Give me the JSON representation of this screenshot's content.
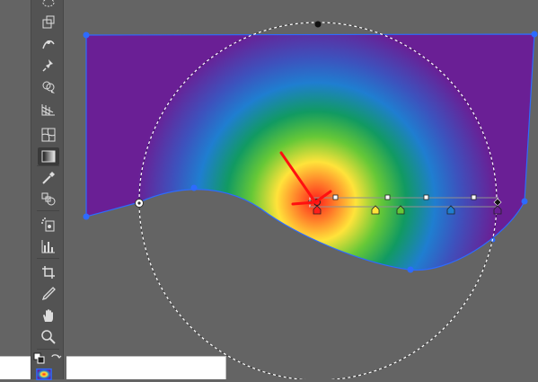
{
  "canvas": {
    "background_color": "#646464",
    "artwork_fill_outer_color": "#6a1f95",
    "gradient_stops": [
      "#ff2a1e",
      "#ffe23a",
      "#7fcf3c",
      "#0f9a5a",
      "#1d78c6",
      "#6a1f95"
    ],
    "selection_color": "#2d6bff",
    "gradient_annotator_color": "#ffffff"
  },
  "toolbar": {
    "tools": [
      {
        "name": "lasso-tool",
        "icon": "lasso-icon"
      },
      {
        "name": "free-transform-tool",
        "icon": "free-transform-icon"
      },
      {
        "name": "puppet-warp-tool",
        "icon": "puppet-warp-icon"
      },
      {
        "name": "pin-tool",
        "icon": "pin-icon"
      },
      {
        "name": "shape-builder-tool",
        "icon": "shape-builder-icon"
      },
      {
        "name": "perspective-grid-tool",
        "icon": "perspective-grid-icon"
      },
      {
        "name": "mesh-tool",
        "icon": "mesh-icon"
      },
      {
        "name": "gradient-tool",
        "icon": "gradient-icon",
        "active": true
      },
      {
        "name": "eyedropper-tool",
        "icon": "eyedropper-icon"
      },
      {
        "name": "blend-tool",
        "icon": "blend-icon"
      },
      {
        "name": "symbol-sprayer-tool",
        "icon": "symbol-sprayer-icon"
      },
      {
        "name": "column-graph-tool",
        "icon": "column-graph-icon"
      },
      {
        "name": "artboard-tool",
        "icon": "artboard-icon"
      },
      {
        "name": "slice-tool",
        "icon": "slice-icon"
      },
      {
        "name": "hand-tool",
        "icon": "hand-icon"
      },
      {
        "name": "zoom-tool",
        "icon": "zoom-icon"
      },
      {
        "name": "default-fill-stroke",
        "icon": "default-fill-stroke-icon"
      },
      {
        "name": "swap-fill-stroke",
        "icon": "swap-fill-stroke-icon"
      }
    ]
  }
}
